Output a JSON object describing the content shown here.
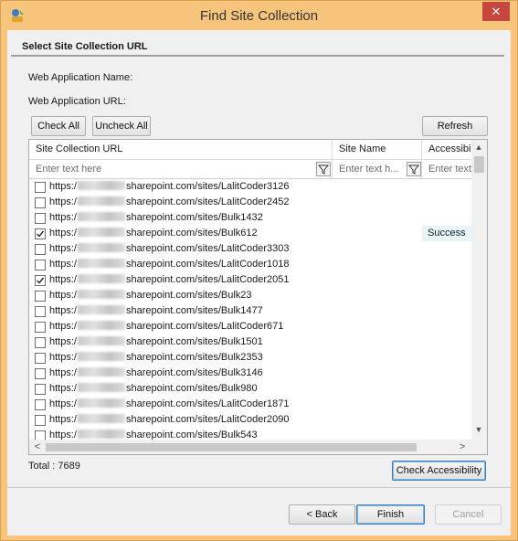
{
  "window": {
    "title": "Find Site Collection",
    "close_symbol": "✕"
  },
  "section": {
    "title": "Select Site Collection URL"
  },
  "labels": {
    "web_app_name": "Web Application Name:",
    "web_app_url": "Web Application URL:"
  },
  "buttons": {
    "check_all": "Check All",
    "uncheck_all": "Uncheck All",
    "refresh": "Refresh",
    "check_accessibility": "Check Accessibility",
    "back": "< Back",
    "finish": "Finish",
    "cancel": "Cancel"
  },
  "grid": {
    "columns": [
      "Site Collection URL",
      "Site Name",
      "Accessibili"
    ],
    "filters": [
      "Enter text here",
      "Enter text h...",
      "Enter text"
    ],
    "rows": [
      {
        "url_prefix": "https:/",
        "url_suffix": "sharepoint.com/sites/LalitCoder3126",
        "checked": false,
        "accessibility": ""
      },
      {
        "url_prefix": "https:/",
        "url_suffix": "sharepoint.com/sites/LalitCoder2452",
        "checked": false,
        "accessibility": ""
      },
      {
        "url_prefix": "https:/",
        "url_suffix": "sharepoint.com/sites/Bulk1432",
        "checked": false,
        "accessibility": ""
      },
      {
        "url_prefix": "https:/",
        "url_suffix": "sharepoint.com/sites/Bulk612",
        "checked": true,
        "accessibility": "Success"
      },
      {
        "url_prefix": "https:/",
        "url_suffix": "sharepoint.com/sites/LalitCoder3303",
        "checked": false,
        "accessibility": ""
      },
      {
        "url_prefix": "https:/",
        "url_suffix": "sharepoint.com/sites/LalitCoder1018",
        "checked": false,
        "accessibility": ""
      },
      {
        "url_prefix": "https:/",
        "url_suffix": "sharepoint.com/sites/LalitCoder2051",
        "checked": true,
        "accessibility": ""
      },
      {
        "url_prefix": "https:/",
        "url_suffix": "sharepoint.com/sites/Bulk23",
        "checked": false,
        "accessibility": ""
      },
      {
        "url_prefix": "https:/",
        "url_suffix": "sharepoint.com/sites/Bulk1477",
        "checked": false,
        "accessibility": ""
      },
      {
        "url_prefix": "https:/",
        "url_suffix": "sharepoint.com/sites/LalitCoder671",
        "checked": false,
        "accessibility": ""
      },
      {
        "url_prefix": "https:/",
        "url_suffix": "sharepoint.com/sites/Bulk1501",
        "checked": false,
        "accessibility": ""
      },
      {
        "url_prefix": "https:/",
        "url_suffix": "sharepoint.com/sites/Bulk2353",
        "checked": false,
        "accessibility": ""
      },
      {
        "url_prefix": "https:/",
        "url_suffix": "sharepoint.com/sites/Bulk3146",
        "checked": false,
        "accessibility": ""
      },
      {
        "url_prefix": "https:/",
        "url_suffix": "sharepoint.com/sites/Bulk980",
        "checked": false,
        "accessibility": ""
      },
      {
        "url_prefix": "https:/",
        "url_suffix": "sharepoint.com/sites/LalitCoder1871",
        "checked": false,
        "accessibility": ""
      },
      {
        "url_prefix": "https:/",
        "url_suffix": "sharepoint.com/sites/LalitCoder2090",
        "checked": false,
        "accessibility": ""
      },
      {
        "url_prefix": "https:/",
        "url_suffix": "sharepoint.com/sites/Bulk543",
        "checked": false,
        "accessibility": ""
      }
    ]
  },
  "footer": {
    "total": "Total : 7689"
  },
  "icons": {
    "app": "app-logo-icon",
    "filter": "funnel-icon",
    "scroll_up": "▲",
    "scroll_down": "▼",
    "scroll_left": "<",
    "scroll_right": ">"
  },
  "colors": {
    "titlebar": "#f6c47b",
    "close": "#c7463e",
    "success_bg": "#e6f6fb"
  }
}
